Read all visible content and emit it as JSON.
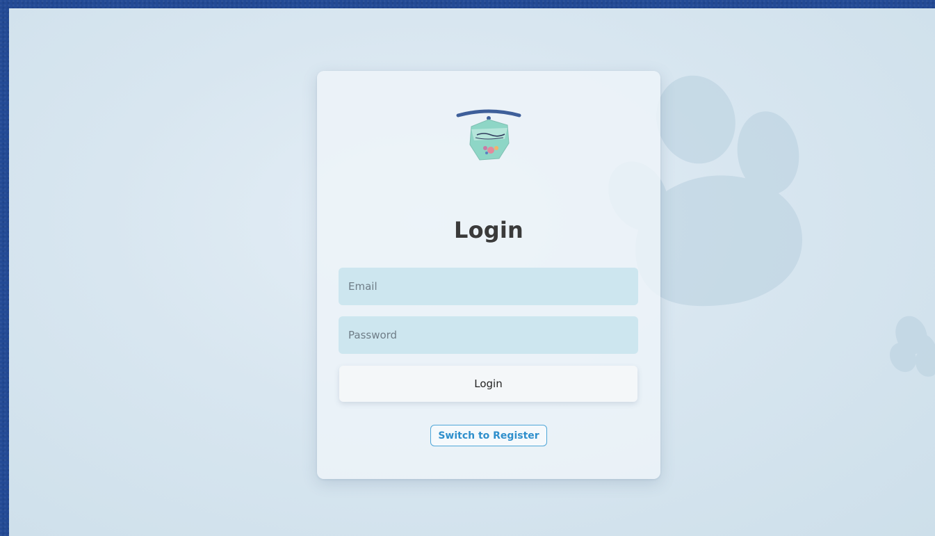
{
  "login": {
    "title": "Login",
    "email_placeholder": "Email",
    "password_placeholder": "Password",
    "login_button": "Login",
    "switch_button": "Switch to Register"
  },
  "colors": {
    "frame_background": "#234a95",
    "field_background": "#cde6ef",
    "switch_text": "#2f8fcc",
    "title_text": "#3a3a3a"
  },
  "icons": {
    "logo": "whiskers-logo-icon",
    "background_decoration": "paw-print-icon"
  }
}
